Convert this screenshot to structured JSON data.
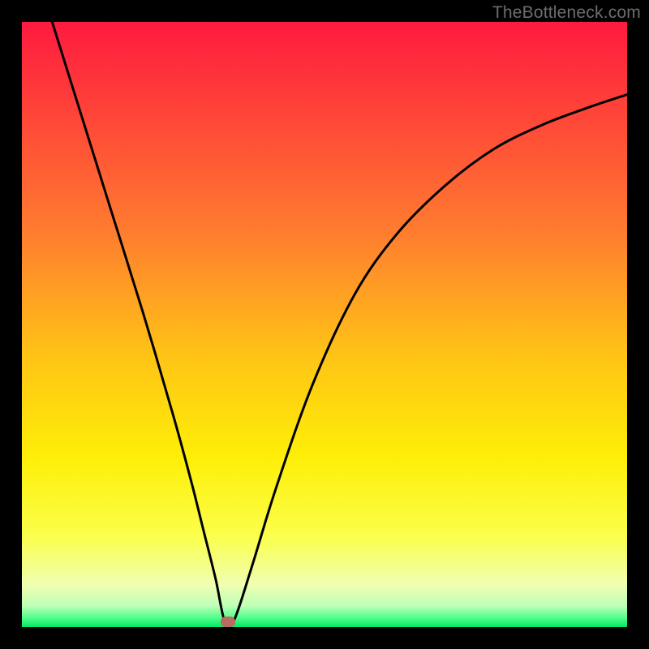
{
  "watermark": "TheBottleneck.com",
  "chart_data": {
    "type": "line",
    "title": "",
    "xlabel": "",
    "ylabel": "",
    "xlim": [
      0,
      100
    ],
    "ylim": [
      0,
      100
    ],
    "background": {
      "description": "vertical gradient from red (top) through orange, yellow, pale-yellow, to thin green band at bottom",
      "stops": [
        {
          "pos": 0.0,
          "color": "#fe1a3f"
        },
        {
          "pos": 0.18,
          "color": "#ff4c37"
        },
        {
          "pos": 0.35,
          "color": "#ff7d2f"
        },
        {
          "pos": 0.55,
          "color": "#ffc316"
        },
        {
          "pos": 0.72,
          "color": "#feef07"
        },
        {
          "pos": 0.85,
          "color": "#fbff4c"
        },
        {
          "pos": 0.93,
          "color": "#f0ffb1"
        },
        {
          "pos": 0.965,
          "color": "#beffb7"
        },
        {
          "pos": 0.985,
          "color": "#4eff8a"
        },
        {
          "pos": 1.0,
          "color": "#00e765"
        }
      ]
    },
    "series": [
      {
        "name": "bottleneck-curve",
        "color": "#000000",
        "x": [
          5,
          10,
          15,
          20,
          25,
          28,
          30,
          32,
          33.5,
          35,
          38,
          42,
          48,
          55,
          62,
          70,
          78,
          86,
          94,
          100
        ],
        "values": [
          100,
          84,
          68,
          52,
          35,
          24,
          16,
          8,
          1,
          1,
          10,
          23,
          40,
          55,
          65,
          73,
          79,
          83,
          86,
          88
        ]
      }
    ],
    "marker": {
      "x": 34,
      "y": 1,
      "color": "#bb6b61"
    },
    "annotations": []
  },
  "colors": {
    "frame": "#000000",
    "curve": "#000000",
    "watermark": "#6d6d6d",
    "marker": "#bb6b61"
  }
}
